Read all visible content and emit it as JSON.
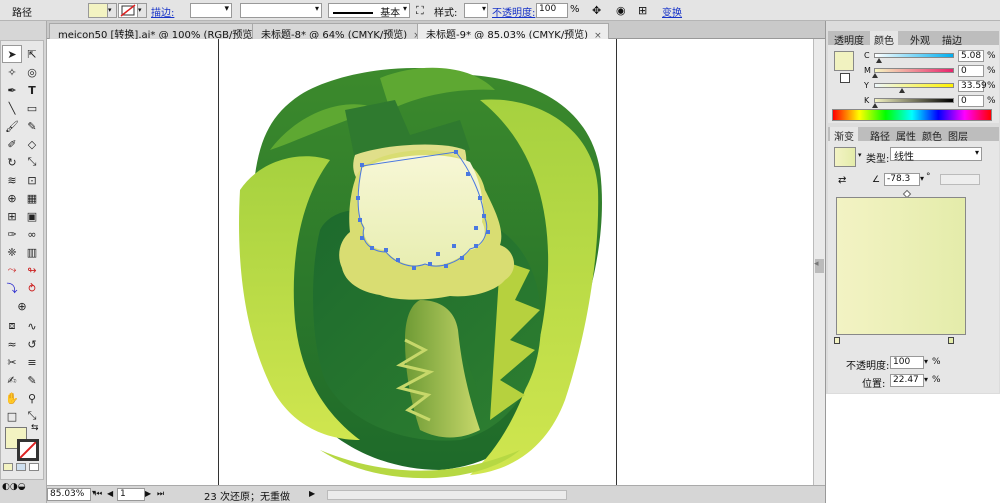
{
  "control": {
    "path_label": "路径",
    "stroke_label": "描边:",
    "stroke_value": "",
    "profile": "基本",
    "style_label": "样式:",
    "opacity_label": "不透明度:",
    "opacity_value": "100",
    "opacity_unit": "%",
    "transform_label": "变换",
    "fill_color": "#f3f3c2"
  },
  "tabs": [
    {
      "label": "meicon50 [转换].ai* @ 100% (RGB/预览)",
      "close": "×"
    },
    {
      "label": "未标题-8* @ 64% (CMYK/预览)",
      "close": "×"
    },
    {
      "label": "未标题-9* @ 85.03% (CMYK/预览)",
      "close": "×"
    }
  ],
  "status": {
    "zoom": "85.03%",
    "page": "1",
    "history": "23 次还原；无重做"
  },
  "color_panel": {
    "tabs": [
      "透明度",
      "颜色",
      "外观",
      "描边"
    ],
    "swatch": "#f1f2c0",
    "channels": [
      {
        "name": "C",
        "value": "5.08"
      },
      {
        "name": "M",
        "value": "0"
      },
      {
        "name": "Y",
        "value": "33.59"
      },
      {
        "name": "K",
        "value": "0"
      }
    ],
    "unit": "%"
  },
  "gradient_panel": {
    "tabs": [
      "渐变",
      "路径",
      "属性",
      "颜色",
      "图层"
    ],
    "type_label": "类型:",
    "type_value": "线性",
    "angle": "-78.3",
    "angle_unit": "°",
    "start_color": "#f3f3c4",
    "end_color": "#e4ecaa",
    "opacity_label": "不透明度:",
    "opacity_value": "100",
    "location_label": "位置:",
    "location_value": "22.47",
    "unit": "%"
  },
  "colors": {
    "dark_green": "#1e6a2a",
    "mid_green": "#4d9a32",
    "light_green": "#a8d246",
    "lime": "#cde24c",
    "cream": "#f3f3c4",
    "selection": "#4a78e0"
  }
}
